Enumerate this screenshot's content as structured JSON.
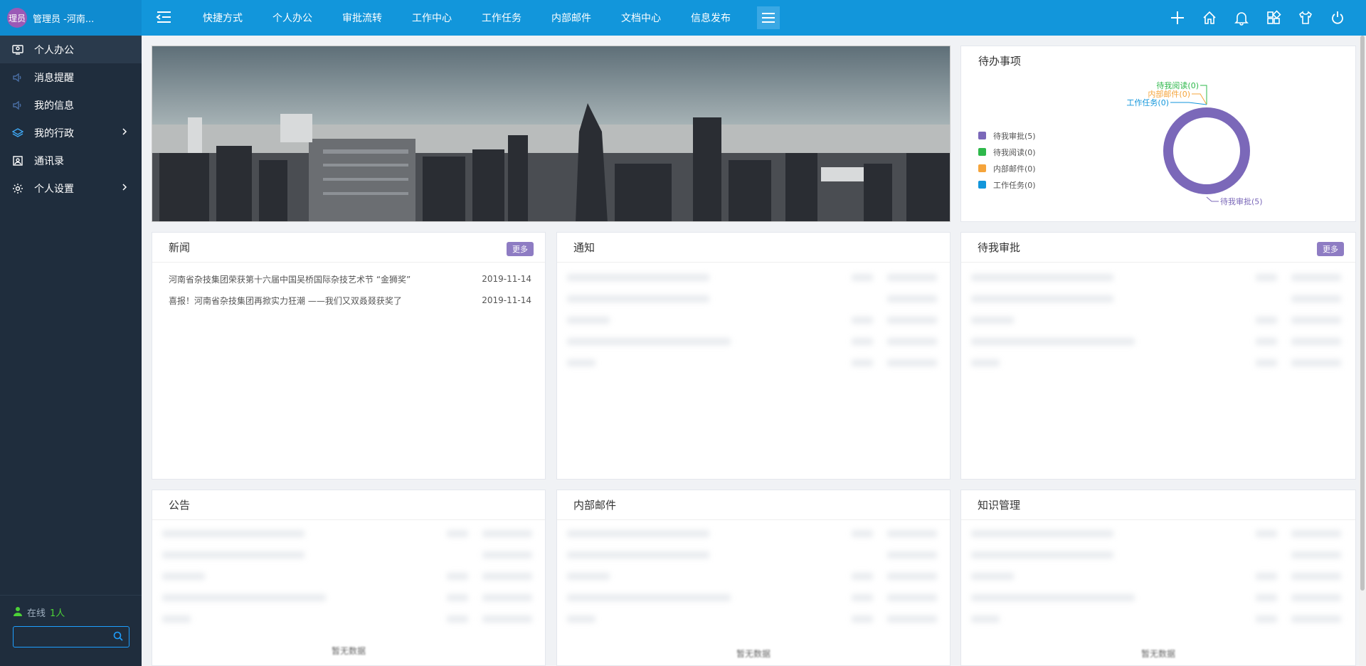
{
  "header": {
    "avatar_text": "理员",
    "user_label": "管理员 -河南...",
    "nav": [
      "快捷方式",
      "个人办公",
      "审批流转",
      "工作中心",
      "工作任务",
      "内部邮件",
      "文档中心",
      "信息发布"
    ],
    "icons": [
      "plus-icon",
      "home-icon",
      "bell-icon",
      "apps-icon",
      "shirt-icon",
      "power-icon"
    ]
  },
  "sidebar": {
    "items": [
      {
        "label": "个人办公",
        "icon": "monitor-icon"
      },
      {
        "label": "消息提醒",
        "icon": "speaker-icon"
      },
      {
        "label": "我的信息",
        "icon": "speaker-icon"
      },
      {
        "label": "我的行政",
        "icon": "layers-icon"
      },
      {
        "label": "通讯录",
        "icon": "contact-icon"
      },
      {
        "label": "个人设置",
        "icon": "gear-icon"
      }
    ],
    "online_label": "在线",
    "online_count": "1人",
    "search_placeholder": ""
  },
  "todo": {
    "title": "待办事项",
    "legend": [
      {
        "label": "待我审批(5)",
        "color": "#7b68b9"
      },
      {
        "label": "待我阅读(0)",
        "color": "#2eb84b"
      },
      {
        "label": "内部邮件(0)",
        "color": "#f5a43b"
      },
      {
        "label": "工作任务(0)",
        "color": "#1296db"
      }
    ],
    "callouts": {
      "read": "待我阅读(0)",
      "mail": "内部邮件(0)",
      "task": "工作任务(0)",
      "approve": "待我审批(5)"
    }
  },
  "chart_data": {
    "type": "pie",
    "categories": [
      "待我审批",
      "待我阅读",
      "内部邮件",
      "工作任务"
    ],
    "values": [
      5,
      0,
      0,
      0
    ],
    "colors": [
      "#7b68b9",
      "#2eb84b",
      "#f5a43b",
      "#1296db"
    ],
    "title": "",
    "legend": "left"
  },
  "news": {
    "title": "新闻",
    "more": "更多",
    "rows": [
      {
        "title": "河南省杂技集团荣获第十六届中国吴桥国际杂技艺术节 “金狮奖”",
        "date": "2019-11-14"
      },
      {
        "title": "喜报！河南省杂技集团再掀实力狂潮 ——我们又双叒叕获奖了",
        "date": "2019-11-14"
      }
    ]
  },
  "notice": {
    "title": "通知"
  },
  "approval": {
    "title": "待我审批",
    "more": "更多"
  },
  "announcement": {
    "title": "公告",
    "empty": "暂无数据"
  },
  "mail": {
    "title": "内部邮件",
    "empty": "暂无数据"
  },
  "knowledge": {
    "title": "知识管理",
    "empty": "暂无数据"
  }
}
